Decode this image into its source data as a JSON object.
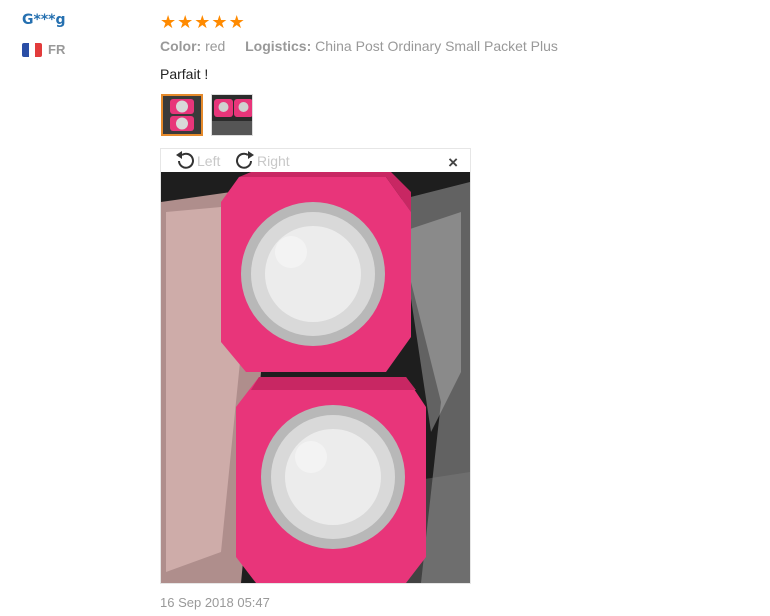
{
  "review": {
    "user_name": "G***g",
    "country_code": "FR",
    "rating": 5,
    "stars": [
      "★",
      "★",
      "★",
      "★",
      "★"
    ],
    "color_label": "Color:",
    "color_value": "red",
    "logistics_label": "Logistics:",
    "logistics_value": "China Post Ordinary Small Packet Plus",
    "feedback": "Parfait !",
    "date": "16 Sep 2018 05:47"
  },
  "viewer": {
    "rotate_left": "Left",
    "rotate_right": "Right",
    "close": "×"
  },
  "colors": {
    "username": "#2570b0",
    "star": "#ff8a00",
    "bowl": "#e8357a",
    "selected_border": "#e58a2c"
  },
  "icons": [
    "flag-fr-icon",
    "star-icon",
    "rotate-left-icon",
    "rotate-right-icon",
    "close-icon"
  ]
}
